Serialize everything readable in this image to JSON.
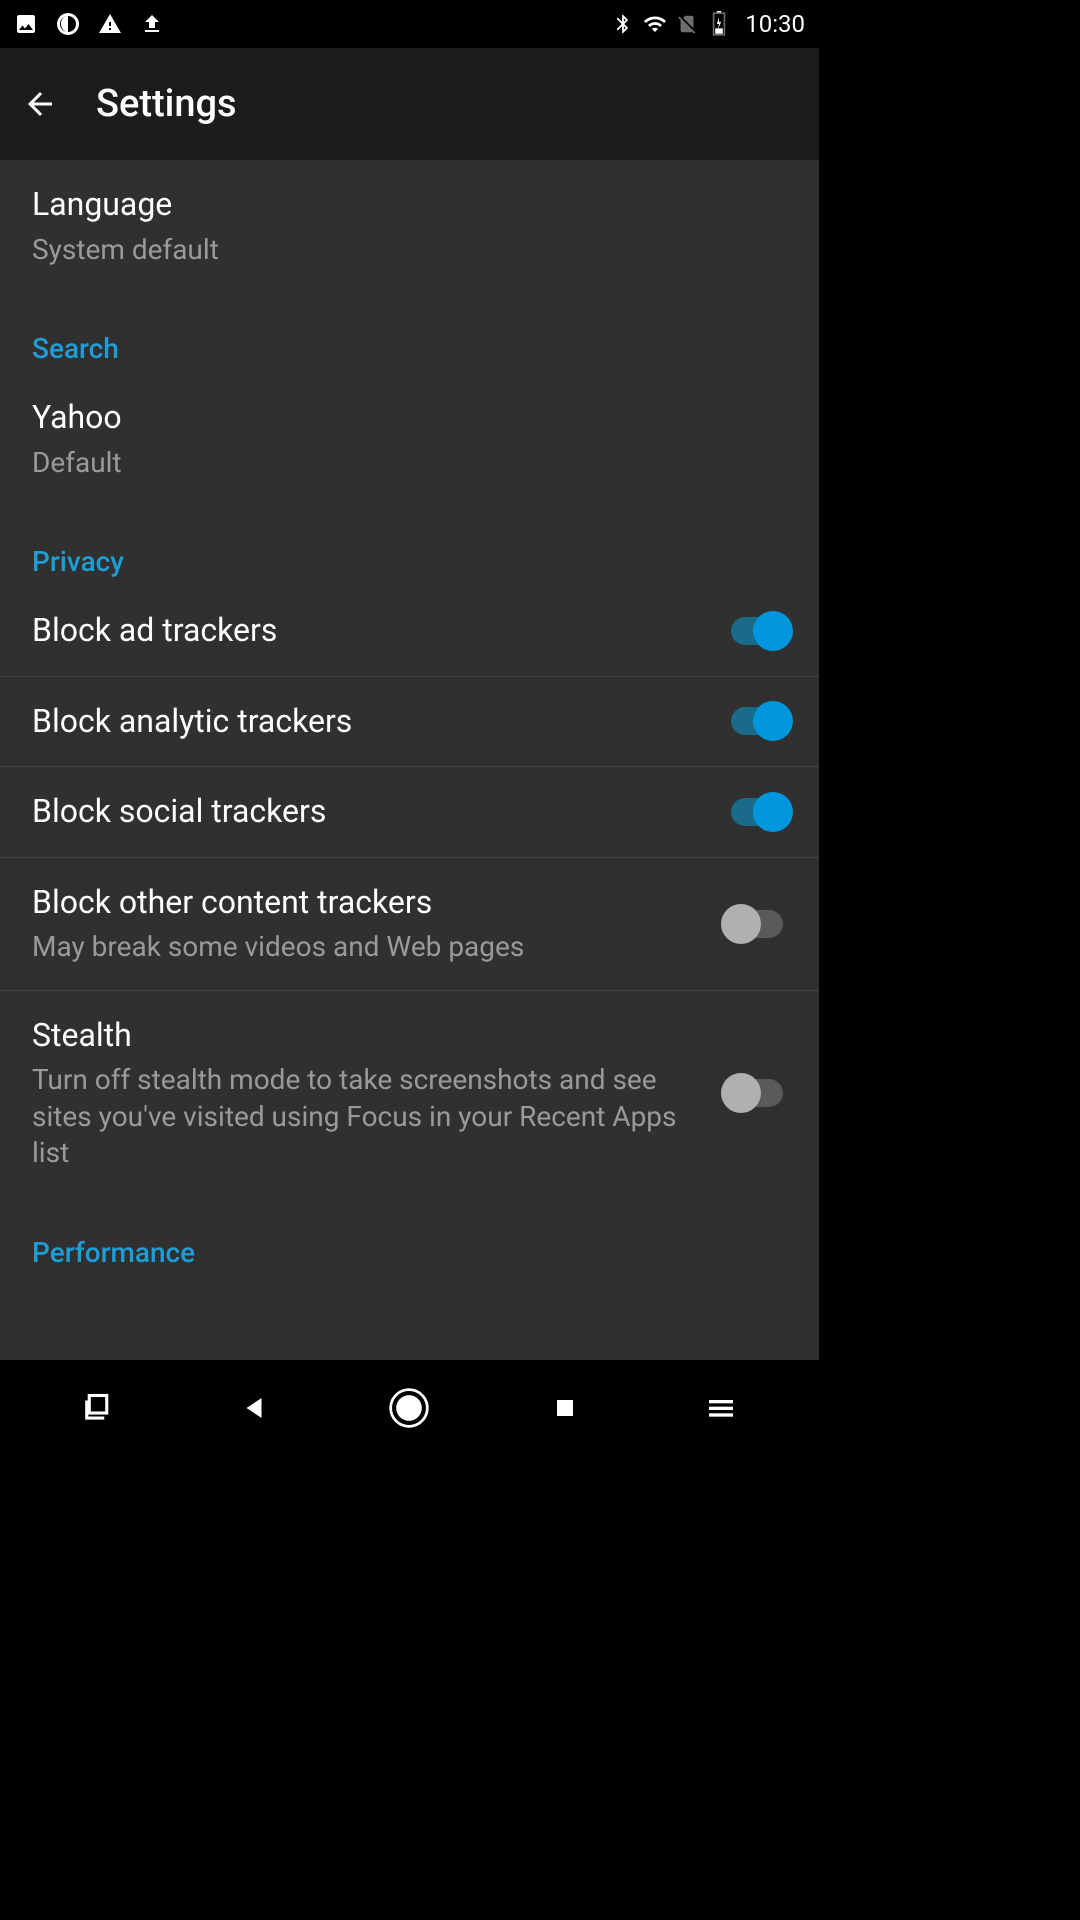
{
  "status_bar": {
    "time": "10:30"
  },
  "app_bar": {
    "title": "Settings"
  },
  "settings": {
    "language": {
      "title": "Language",
      "subtitle": "System default"
    },
    "sections": {
      "search": {
        "header": "Search",
        "engine": {
          "title": "Yahoo",
          "subtitle": "Default"
        }
      },
      "privacy": {
        "header": "Privacy",
        "block_ad": {
          "title": "Block ad trackers",
          "enabled": true
        },
        "block_analytic": {
          "title": "Block analytic trackers",
          "enabled": true
        },
        "block_social": {
          "title": "Block social trackers",
          "enabled": true
        },
        "block_other": {
          "title": "Block other content trackers",
          "subtitle": "May break some videos and Web pages",
          "enabled": false
        },
        "stealth": {
          "title": "Stealth",
          "subtitle": "Turn off stealth mode to take screenshots and see sites you've visited using Focus in your Recent Apps list",
          "enabled": false
        }
      },
      "performance": {
        "header": "Performance"
      }
    }
  }
}
